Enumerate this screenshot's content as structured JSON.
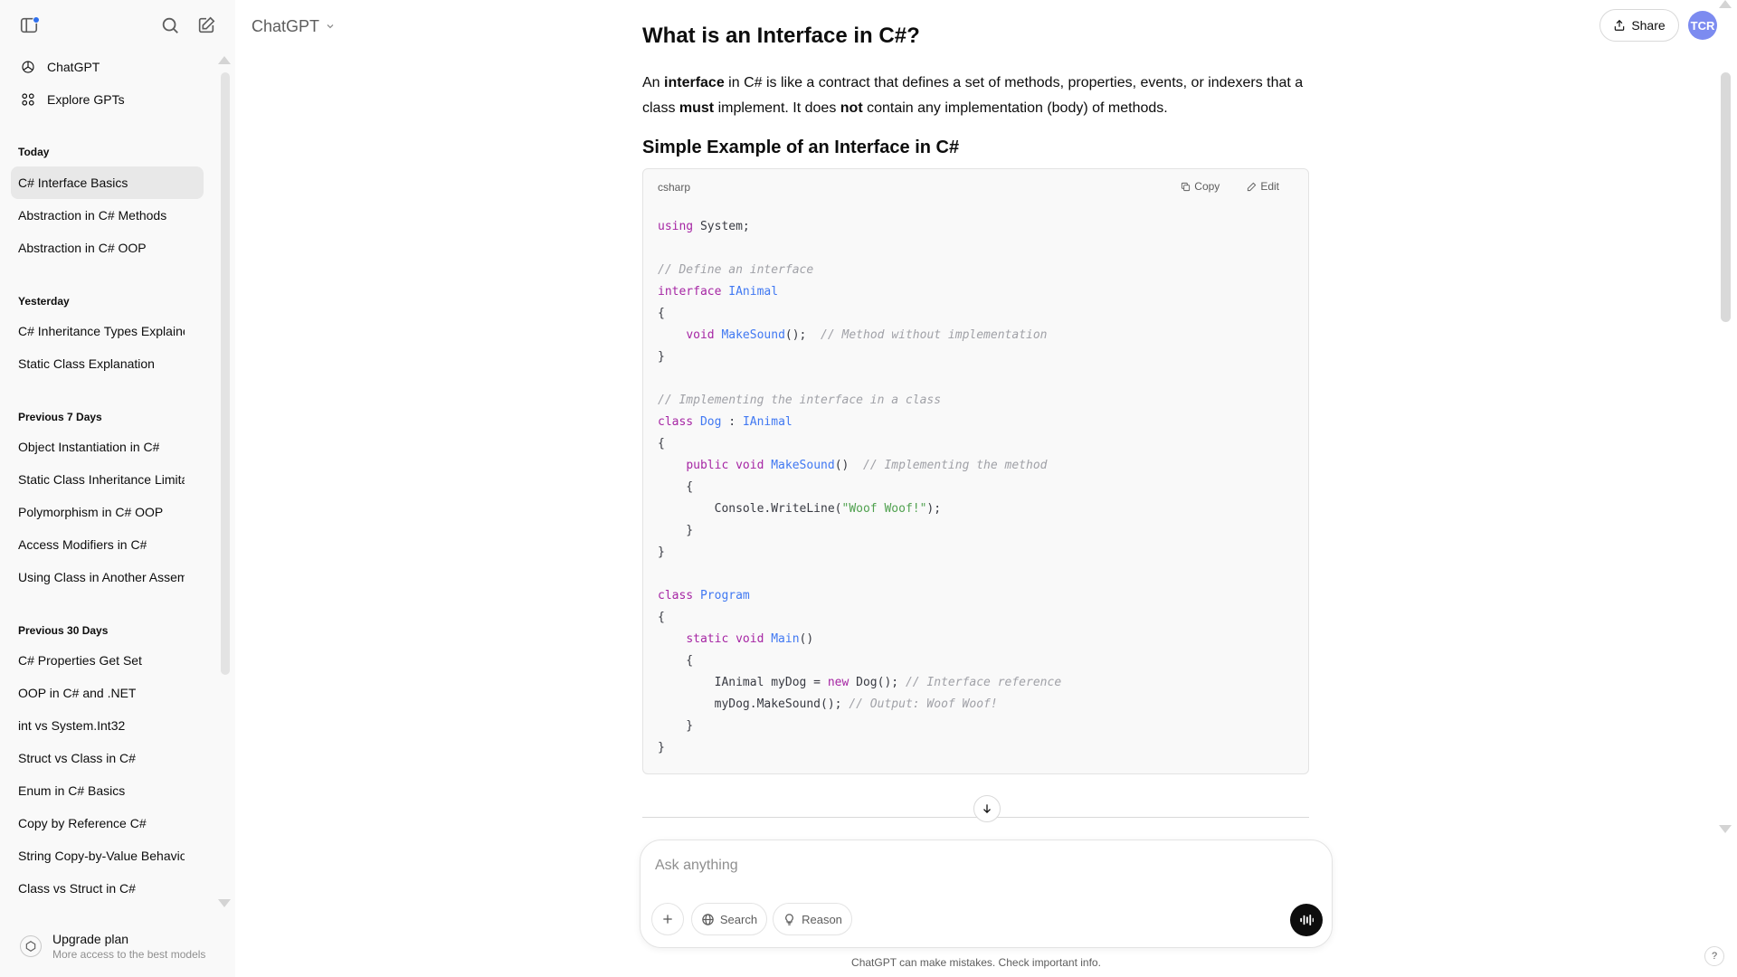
{
  "sidebar": {
    "nav": [
      {
        "label": "ChatGPT",
        "icon": "openai-logo-icon"
      },
      {
        "label": "Explore GPTs",
        "icon": "grid-icon"
      }
    ],
    "groups": [
      {
        "title": "Today",
        "items": [
          "C# Interface Basics",
          "Abstraction in C# Methods",
          "Abstraction in C# OOP"
        ]
      },
      {
        "title": "Yesterday",
        "items": [
          "C# Inheritance Types Explained",
          "Static Class Explanation"
        ]
      },
      {
        "title": "Previous 7 Days",
        "items": [
          "Object Instantiation in C#",
          "Static Class Inheritance Limitations",
          "Polymorphism in C# OOP",
          "Access Modifiers in C#",
          "Using Class in Another Assembly"
        ]
      },
      {
        "title": "Previous 30 Days",
        "items": [
          "C# Properties Get Set",
          "OOP in C# and .NET",
          "int vs System.Int32",
          "Struct vs Class in C#",
          "Enum in C# Basics",
          "Copy by Reference C#",
          "String Copy-by-Value Behavior",
          "Class vs Struct in C#"
        ]
      }
    ],
    "active_chat": "C# Interface Basics",
    "upgrade": {
      "title": "Upgrade plan",
      "subtitle": "More access to the best models"
    }
  },
  "header": {
    "model": "ChatGPT",
    "share_label": "Share",
    "avatar_initials": "TCR"
  },
  "message": {
    "title": "What is an Interface in C#?",
    "para": {
      "p1": "An ",
      "b1": "interface",
      "p2": " in C# is like a contract that defines a set of methods, properties, events, or indexers that a class ",
      "b2": "must",
      "p3": " implement. It does ",
      "b3": "not",
      "p4": " contain any implementation (body) of methods."
    },
    "subtitle": "Simple Example of an Interface in C#",
    "code": {
      "language": "csharp",
      "copy_label": "Copy",
      "edit_label": "Edit",
      "lines": {
        "l1": {
          "k": "using",
          "t": " System;"
        },
        "l3": "// Define an interface",
        "l4": {
          "k": "interface",
          "ty": " IAnimal"
        },
        "l5": "{",
        "l6": {
          "indent": "    ",
          "k": "void",
          "ty": " MakeSound",
          "t": "();  ",
          "c": "// Method without implementation"
        },
        "l7": "}",
        "l9": "// Implementing the interface in a class",
        "l10": {
          "k": "class",
          "ty": " Dog",
          "t": " : ",
          "ty2": "IAnimal"
        },
        "l11": "{",
        "l12": {
          "indent": "    ",
          "k": "public void",
          "ty": " MakeSound",
          "t": "()  ",
          "c": "// Implementing the method"
        },
        "l13": "    {",
        "l14": {
          "t": "        Console.WriteLine(",
          "s": "\"Woof Woof!\"",
          "t2": ");"
        },
        "l15": "    }",
        "l16": "}",
        "l18": {
          "k": "class",
          "ty": " Program"
        },
        "l19": "{",
        "l20": {
          "indent": "    ",
          "k": "static void",
          "ty": " Main",
          "t": "()"
        },
        "l21": "    {",
        "l22": {
          "t": "        IAnimal myDog = ",
          "k": "new",
          "t2": " Dog(); ",
          "c": "// Interface reference"
        },
        "l23": {
          "t": "        myDog.MakeSound(); ",
          "c": "// Output: Woof Woof!"
        },
        "l24": "    }",
        "l25": "}"
      }
    }
  },
  "composer": {
    "placeholder": "Ask anything",
    "search_label": "Search",
    "reason_label": "Reason"
  },
  "disclaimer": "ChatGPT can make mistakes. Check important info.",
  "help_label": "?"
}
